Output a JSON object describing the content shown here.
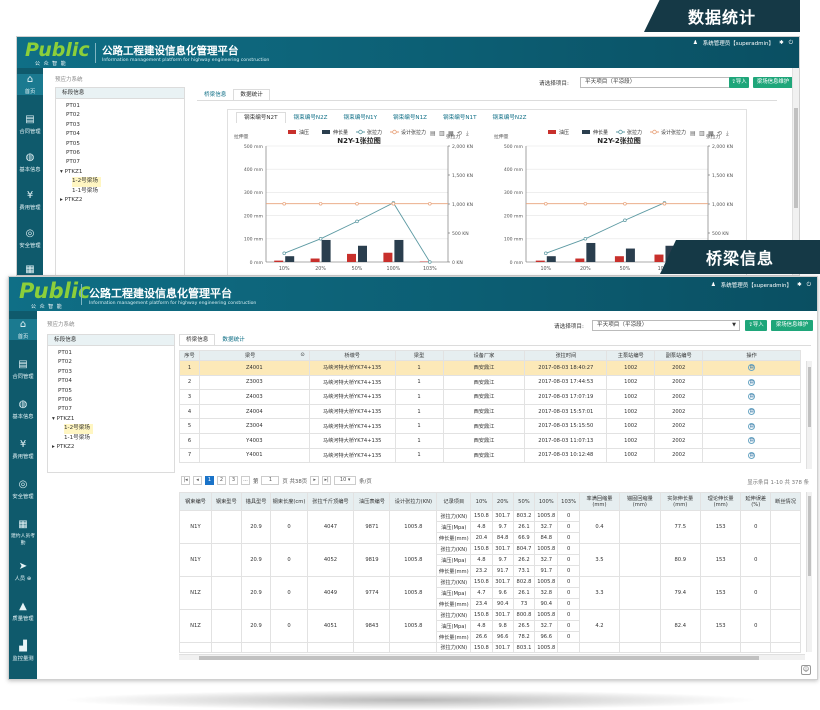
{
  "banners": {
    "stats": "数据统计",
    "bridge": "桥梁信息"
  },
  "app": {
    "logo": "Public",
    "logo_sub": "公 众 智 能",
    "title": "公路工程建设信息化管理平台",
    "subtitle": "Information management platform for highway engineering construction",
    "user": "系统管理员【superadmin】"
  },
  "breadcrumb": "预应力系统",
  "sidebar": [
    {
      "label": "首页",
      "icon": "home-icon",
      "glyph": "⌂"
    },
    {
      "label": "合同管理",
      "icon": "document-icon",
      "glyph": "▤"
    },
    {
      "label": "基本信息",
      "icon": "globe-icon",
      "glyph": "◍"
    },
    {
      "label": "费用管理",
      "icon": "yen-icon",
      "glyph": "¥"
    },
    {
      "label": "安全管理",
      "icon": "lifebuoy-icon",
      "glyph": "◎"
    },
    {
      "label": "建约人员考勤",
      "icon": "calendar-icon",
      "glyph": "▦"
    },
    {
      "label": "人员",
      "icon": "location-icon",
      "glyph": "➤"
    },
    {
      "label": "质量管理",
      "icon": "quality-icon",
      "glyph": "▲"
    },
    {
      "label": "监控量测",
      "icon": "monitor-icon",
      "glyph": "▟"
    }
  ],
  "tree": {
    "header": "标段信息",
    "items": [
      "PT01",
      "PT02",
      "PT03",
      "PT04",
      "PT05",
      "PT06",
      "PT07",
      "PTKZ1",
      "1-2号梁场",
      "1-1号梁场",
      "PTKZ2"
    ]
  },
  "tabs": {
    "bridge_info": "桥梁信息",
    "data_stats": "数据统计"
  },
  "project_select": {
    "label": "请选择项目:",
    "value": "平天项目（平凉段）"
  },
  "buttons": {
    "import": "导入",
    "maintain": "梁场信息维护"
  },
  "charts_panel": {
    "sub_tabs": [
      "钢束编号N2T",
      "钢束编号N2Z",
      "钢束编号N1Y",
      "钢束编号N1Z",
      "钢束编号N1T",
      "钢束编号N2Z"
    ],
    "legend": [
      "油压",
      "伸长量",
      "张拉力",
      "设计张拉力"
    ],
    "left_axis_label": "拉伸量",
    "right_axis_label": "张拉力"
  },
  "chart_data": [
    {
      "type": "bar",
      "title": "N2Y-1张拉图",
      "categories": [
        "10%",
        "20%",
        "50%",
        "100%",
        "103%"
      ],
      "y_ticks": [
        "0 mm",
        "100 mm",
        "200 mm",
        "300 mm",
        "400 mm",
        "500 mm"
      ],
      "y2_ticks": [
        "0 KN",
        "500 KN",
        "1,000 KN",
        "1,500 KN",
        "2,000 KN"
      ],
      "ylim": [
        0,
        500
      ],
      "y2lim": [
        0,
        2000
      ],
      "series": [
        {
          "name": "油压",
          "type": "bar",
          "unit": "mm",
          "values": [
            6,
            15,
            35,
            40,
            2
          ]
        },
        {
          "name": "伸长量",
          "type": "bar",
          "unit": "mm",
          "values": [
            25,
            95,
            70,
            95,
            0
          ]
        },
        {
          "name": "张拉力",
          "type": "line",
          "unit": "KN",
          "values": [
            150,
            400,
            700,
            1020,
            0
          ]
        },
        {
          "name": "设计张拉力",
          "type": "line",
          "unit": "KN",
          "values": [
            1005,
            1005,
            1005,
            1005,
            1005
          ]
        }
      ]
    },
    {
      "type": "bar",
      "title": "N2Y-2张拉图",
      "categories": [
        "10%",
        "20%",
        "50%",
        "100%"
      ],
      "y_ticks": [
        "0 mm",
        "100 mm",
        "200 mm",
        "300 mm",
        "400 mm",
        "500 mm"
      ],
      "y2_ticks": [
        "0 KN",
        "500 KN",
        "1,000 KN",
        "1,500 KN",
        "2,000 KN"
      ],
      "ylim": [
        0,
        500
      ],
      "y2lim": [
        0,
        2000
      ],
      "series": [
        {
          "name": "油压",
          "type": "bar",
          "unit": "mm",
          "values": [
            6,
            15,
            25,
            32
          ]
        },
        {
          "name": "伸长量",
          "type": "bar",
          "unit": "mm",
          "values": [
            25,
            82,
            58,
            70
          ]
        },
        {
          "name": "张拉力",
          "type": "line",
          "unit": "KN",
          "values": [
            150,
            400,
            720,
            1020
          ]
        },
        {
          "name": "设计张拉力",
          "type": "line",
          "unit": "KN",
          "values": [
            1005,
            1005,
            1005,
            1005
          ]
        }
      ]
    }
  ],
  "beam_table": {
    "headers": [
      "序号",
      "梁号",
      "",
      "桥墩号",
      "梁型",
      "设备厂家",
      "张拉时间",
      "主泵站编号",
      "副泵站编号",
      "操作"
    ],
    "rows": [
      [
        "1",
        "Z4001",
        "马峡河特大桥YK74+135",
        "1",
        "西安鼎江",
        "2017-08-03 18:40:27",
        "1002",
        "2002"
      ],
      [
        "2",
        "Z3003",
        "马峡河特大桥YK74+135",
        "1",
        "西安鼎江",
        "2017-08-03 17:44:53",
        "1002",
        "2002"
      ],
      [
        "3",
        "Z4003",
        "马峡河特大桥YK74+135",
        "1",
        "西安鼎江",
        "2017-08-03 17:07:19",
        "1002",
        "2002"
      ],
      [
        "4",
        "Z4004",
        "马峡河特大桥YK74+135",
        "1",
        "西安鼎江",
        "2017-08-03 15:57:01",
        "1002",
        "2002"
      ],
      [
        "5",
        "Z3004",
        "马峡河特大桥YK74+135",
        "1",
        "西安鼎江",
        "2017-08-03 15:15:50",
        "1002",
        "2002"
      ],
      [
        "6",
        "Y4003",
        "马峡河特大桥YK74+135",
        "1",
        "西安鼎江",
        "2017-08-03 11:07:13",
        "1002",
        "2002"
      ],
      [
        "7",
        "Y4001",
        "马峡河特大桥YK74+135",
        "1",
        "西安鼎江",
        "2017-08-03 10:12:48",
        "1002",
        "2002"
      ]
    ]
  },
  "pager": {
    "pages": [
      "1",
      "2",
      "3",
      "...",
      "第"
    ],
    "page_input": "1",
    "total_pages": "页 共38页",
    "page_size": "10",
    "per_page": "条/页",
    "summary": "显示条目 1-10 共 378 条"
  },
  "detail_table": {
    "headers": [
      "钢束编号",
      "钢束型号",
      "锚具型号",
      "钢束长度(cm)",
      "张拉千斤顶编号",
      "油压表编号",
      "设计张拉力(KN)",
      "记录项目",
      "10%",
      "20%",
      "50%",
      "100%",
      "103%",
      "率满回缩量(mm)",
      "锚固回缩量(mm)",
      "实际伸长量(mm)",
      "理论伸长量(mm)",
      "延伸误差(%)",
      "断丝情况"
    ],
    "groups": [
      {
        "id": "N1Y",
        "anchor": "20.9",
        "len": "0",
        "jack": "4047",
        "gauge": "9871",
        "design": "1005.8",
        "rows": [
          [
            "张拉力(KN)",
            "150.8",
            "301.7",
            "803.2",
            "1005.8",
            "0"
          ],
          [
            "油压(Mpa)",
            "4.8",
            "9.7",
            "26.1",
            "32.7",
            "0"
          ],
          [
            "伸长量(mm)",
            "20.4",
            "84.8",
            "66.9",
            "84.8",
            "0"
          ]
        ],
        "ret": "0.4",
        "actual": "77.5",
        "theory": "153",
        "err": "0"
      },
      {
        "id": "N1Y",
        "anchor": "20.9",
        "len": "0",
        "jack": "4052",
        "gauge": "9819",
        "design": "1005.8",
        "rows": [
          [
            "张拉力(KN)",
            "150.8",
            "301.7",
            "804.7",
            "1005.8",
            "0"
          ],
          [
            "油压(Mpa)",
            "4.8",
            "9.7",
            "26.2",
            "32.7",
            "0"
          ],
          [
            "伸长量(mm)",
            "23.2",
            "91.7",
            "73.1",
            "91.7",
            "0"
          ]
        ],
        "ret": "3.5",
        "actual": "80.9",
        "theory": "153",
        "err": "0"
      },
      {
        "id": "N1Z",
        "anchor": "20.9",
        "len": "0",
        "jack": "4049",
        "gauge": "9774",
        "design": "1005.8",
        "rows": [
          [
            "张拉力(KN)",
            "150.8",
            "301.7",
            "802.8",
            "1005.8",
            "0"
          ],
          [
            "油压(Mpa)",
            "4.7",
            "9.6",
            "26.1",
            "32.8",
            "0"
          ],
          [
            "伸长量(mm)",
            "23.4",
            "90.4",
            "73",
            "90.4",
            "0"
          ]
        ],
        "ret": "3.3",
        "actual": "79.4",
        "theory": "153",
        "err": "0"
      },
      {
        "id": "N1Z",
        "anchor": "20.9",
        "len": "0",
        "jack": "4051",
        "gauge": "9843",
        "design": "1005.8",
        "rows": [
          [
            "张拉力(KN)",
            "150.8",
            "301.7",
            "800.8",
            "1005.8",
            "0"
          ],
          [
            "油压(Mpa)",
            "4.8",
            "9.8",
            "26.5",
            "32.7",
            "0"
          ],
          [
            "伸长量(mm)",
            "26.6",
            "96.6",
            "78.2",
            "96.6",
            "0"
          ]
        ],
        "ret": "4.2",
        "actual": "82.4",
        "theory": "153",
        "err": "0"
      }
    ],
    "partial_row": [
      "张拉力(KN)",
      "150.8",
      "301.7",
      "803.1",
      "1005.8"
    ]
  },
  "colors": {
    "header": "#0f6f86",
    "sidebar": "#0f5a6c",
    "oil": "#c8302c",
    "elong": "#2a3e4e",
    "force": "#5d9aa3",
    "design": "#e8a27a",
    "accent": "#1fa67a"
  }
}
